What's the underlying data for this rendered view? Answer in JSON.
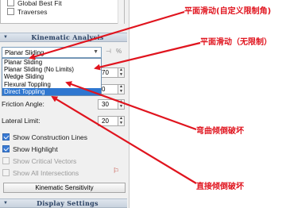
{
  "tree": {
    "items": [
      {
        "label": "Global Best Fit"
      },
      {
        "label": "Traverses"
      }
    ]
  },
  "kinematic_section": {
    "title": "Kinematic Analysis"
  },
  "mode_select": {
    "value": "Planar Sliding"
  },
  "dropdown": {
    "options": [
      {
        "label": "Planar Sliding",
        "selected": false
      },
      {
        "label": "Planar Sliding (No Limits)",
        "selected": false
      },
      {
        "label": "Wedge Sliding",
        "selected": false
      },
      {
        "label": "Flexural Toppling",
        "selected": false
      },
      {
        "label": "Direct Toppling",
        "selected": true
      }
    ]
  },
  "fields": {
    "value_1": "70",
    "value_2": "0",
    "value_3": "0",
    "friction_angle_label": "Friction Angle:",
    "friction_angle_value": "30",
    "lateral_limit_label": "Lateral Limit:",
    "lateral_limit_value": "20"
  },
  "checkboxes": [
    {
      "label": "Show Construction Lines",
      "checked": true,
      "enabled": true
    },
    {
      "label": "Show Highlight",
      "checked": true,
      "enabled": true
    },
    {
      "label": "Show Critical Vectors",
      "checked": false,
      "enabled": false
    },
    {
      "label": "Show All Intersections",
      "checked": false,
      "enabled": false
    }
  ],
  "sensitivity_button": {
    "label": "Kinematic Sensitivity"
  },
  "display_section": {
    "title": "Display Settings"
  },
  "annotations": {
    "a1": "平面滑动(自定义限制角)",
    "a2": "平面滑动（无限制）",
    "a3": "弯曲倾倒破坏",
    "a4": "直接倾倒破坏"
  },
  "colors": {
    "annotation": "#e0141e",
    "selection": "#2f77d0",
    "header": "#2b4264"
  }
}
